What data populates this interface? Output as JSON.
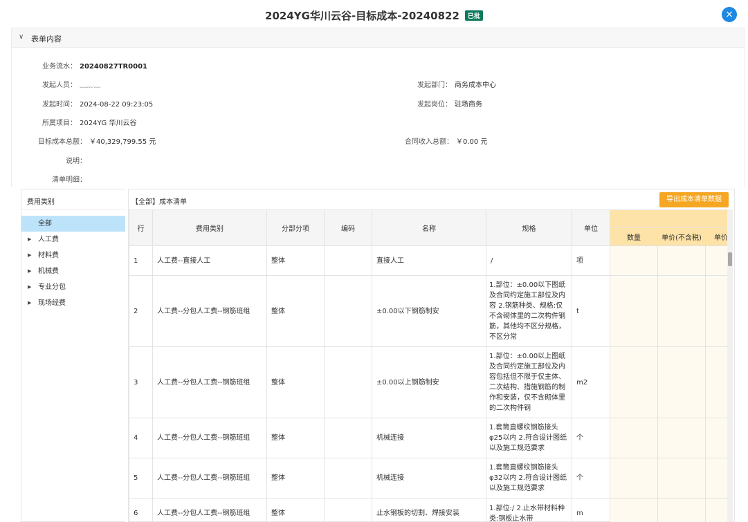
{
  "modal": {
    "title": "2024YG华川云谷-目标成本-20240822",
    "status_badge": "已批",
    "close_icon": "×"
  },
  "section": {
    "label": "表单内容",
    "chevron": "∨"
  },
  "form": {
    "serial_label": "业务流水：",
    "serial_value": "20240827TR0001",
    "initiator_label": "发起人员：",
    "initiator_value": "﹏﹏ ﹏",
    "dept_label": "发起部门：",
    "dept_value": "商务成本中心",
    "time_label": "发起时间：",
    "time_value": "2024-08-22 09:23:05",
    "post_label": "发起岗位：",
    "post_value": "驻场商务",
    "project_label": "所属项目：",
    "project_value": "2024YG  华川云谷",
    "target_cost_label": "目标成本总额：",
    "target_cost_value": "￥40,329,799.55 元",
    "contract_income_label": "合同收入总额：",
    "contract_income_value": "￥0.00 元",
    "note_label": "说明：",
    "detail_label": "清单明细："
  },
  "left_panel": {
    "header": "费用类别",
    "items": [
      {
        "label": "全部",
        "arrow": ""
      },
      {
        "label": "人工费",
        "arrow": "▶"
      },
      {
        "label": "材料费",
        "arrow": "▶"
      },
      {
        "label": "机械费",
        "arrow": "▶"
      },
      {
        "label": "专业分包",
        "arrow": "▶"
      },
      {
        "label": "现场经费",
        "arrow": "▶"
      }
    ]
  },
  "right_panel": {
    "title": "【全部】成本清单",
    "export_button": "导出成本清单数据",
    "columns": [
      "行",
      "费用类别",
      "分部分项",
      "编码",
      "名称",
      "规格",
      "单位",
      "数量",
      "单价(不含税)",
      "单价("
    ],
    "rows": [
      {
        "no": "1",
        "category": "人工费--直接人工",
        "part": "整体",
        "code": "",
        "name": "直接人工",
        "spec": "/",
        "unit": "项"
      },
      {
        "no": "2",
        "category": "人工费--分包人工费--钢筋班组",
        "part": "整体",
        "code": "",
        "name": "±0.00以下钢筋制安",
        "spec": "1.部位：±0.00以下图纸及合同约定施工部位及内容 2.钢筋种类、规格:仅不含砌体里的二次构件钢筋，其他均不区分规格，不区分常",
        "unit": "t"
      },
      {
        "no": "3",
        "category": "人工费--分包人工费--钢筋班组",
        "part": "整体",
        "code": "",
        "name": "±0.00以上钢筋制安",
        "spec": "1.部位：±0.00以上图纸及合同约定施工部位及内容包括但不限于仅主体、二次结构、措施钢筋的制作和安装，仅不含砌体里的二次构件钢",
        "unit": "m2"
      },
      {
        "no": "4",
        "category": "人工费--分包人工费--钢筋班组",
        "part": "整体",
        "code": "",
        "name": "机械连接",
        "spec": "1.套筒直螺纹钢筋接头 φ25以内 2.符合设计图纸以及施工规范要求",
        "unit": "个"
      },
      {
        "no": "5",
        "category": "人工费--分包人工费--钢筋班组",
        "part": "整体",
        "code": "",
        "name": "机械连接",
        "spec": "1.套筒直螺纹钢筋接头 φ32以内 2.符合设计图纸以及施工规范要求",
        "unit": "个"
      },
      {
        "no": "6",
        "category": "人工费--分包人工费--钢筋班组",
        "part": "整体",
        "code": "",
        "name": "止水钢板的切割、焊接安装",
        "spec": "1.部位:/ 2.止水带材料种类:钢板止水带",
        "unit": "m"
      }
    ]
  },
  "colors": {
    "accent": "#1e88e5",
    "export": "#f5a623",
    "badge": "#0b7b5c",
    "active_tree": "#bde3fb",
    "orange_header": "#fde3a7"
  }
}
